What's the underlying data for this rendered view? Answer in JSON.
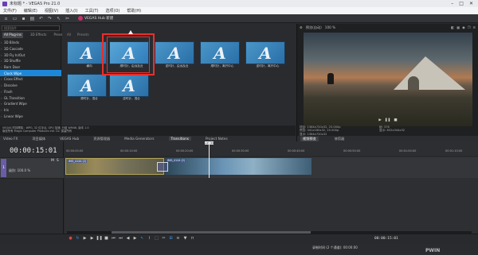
{
  "window": {
    "title": "未标题 * - VEGAS Pro 21.0",
    "app_icon": "vegas-icon"
  },
  "menu": [
    "文件(F)",
    "编辑(E)",
    "视图(V)",
    "插入(I)",
    "工具(T)",
    "选项(O)",
    "帮助(H)"
  ],
  "hub": {
    "label": "VEGAS Hub 新建"
  },
  "left_panel": {
    "search_placeholder": "搜索插件",
    "subtabs": [
      "All Plug-ins",
      "3D Effects",
      "Presets",
      "Wipes",
      "Slides",
      "Iris"
    ],
    "transitions": [
      "3D Blinds",
      "3D Cascade",
      "3D Fly In/Out",
      "3D Shuffle",
      "Barn Door",
      "Clock Wipe",
      "Cross Effect",
      "Dissolve",
      "Flash",
      "GL Transition",
      "Gradient Wipe",
      "Iris",
      "Linear Wipe"
    ],
    "selected_index": 5
  },
  "thumbs": {
    "tabs": [
      "All",
      "Presets"
    ],
    "row1": [
      "横向",
      "顺时针，由远及近",
      "逆时针，由远及近",
      "顺时针，离开中心",
      "逆时针，离开中心"
    ],
    "row2": [
      "顺时针，混合",
      "逆时针，混合"
    ]
  },
  "info": {
    "line1": "VEGAS 时钟擦除：WPG, 32 位浮点, GPU 加速, 分组 WM46, 版本 1.0",
    "line2": "版权所有 Magix Computer Products Intl. Co. 保留所有"
  },
  "pane_tabs": [
    "Video FX",
    "项目媒体",
    "VEGAS Hub",
    "资源管理器",
    "Media Generators",
    "Transitions",
    "Project Notes"
  ],
  "pane_tab_active": 5,
  "preview": {
    "toolbar_label": "预览(自动)",
    "zoom": "100 %",
    "project_line": "项目: 1364x720x32, 25.000p",
    "preview_line": "预览: 341x180x32, 25.000p",
    "display_line": "显示: 1364x720x32",
    "frame_line": "帧: 376",
    "display_size": "显示: 652x344x32",
    "tabs": [
      "视频预览",
      "修剪器"
    ]
  },
  "timeline": {
    "timecode": "00:00:15:01",
    "track_number": "1",
    "level": "级别: 100.0 %",
    "ms": [
      "M",
      "S"
    ],
    "rate": "速率: 0.00",
    "ruler_ticks": [
      "00:00:00:00",
      "00:00:10:00",
      "00:00:20:00",
      "00:00:30:00",
      "00:00:40:00",
      "00:00:50:00",
      "00:01:00:00",
      "00:01:10:00"
    ],
    "playhead_label": "+19:24",
    "clips": [
      "IMG_4144 (2)",
      "IMG_4144 (2)"
    ],
    "end_time": "00:00:15:01",
    "record_time": "录制时间 (2 个通道): 00:00:00"
  },
  "watermark": "PWIN"
}
